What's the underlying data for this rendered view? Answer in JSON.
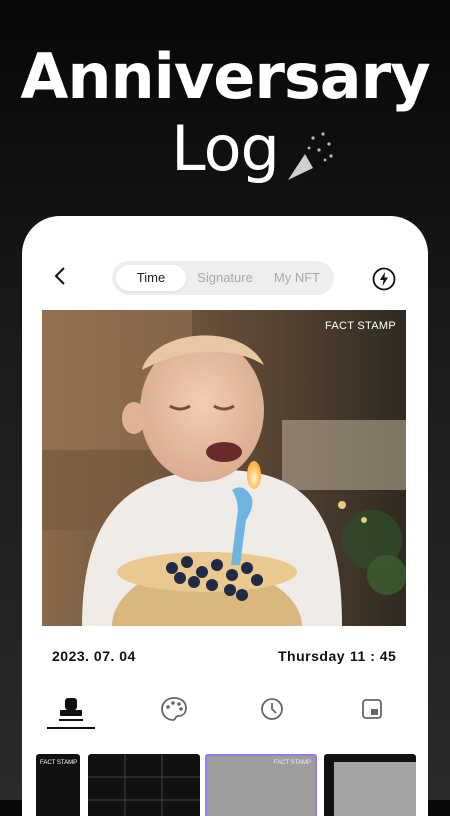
{
  "headline": {
    "line1": "Anniversary",
    "line2": "Log"
  },
  "tabs": [
    {
      "label": "Time"
    },
    {
      "label": "Signature"
    },
    {
      "label": "My NFT"
    }
  ],
  "photo": {
    "stamp_label": "FACT STAMP"
  },
  "info": {
    "date": "2023. 07. 04",
    "day": "Thursday",
    "time": "11 : 45"
  },
  "tools": [
    "stamp-icon",
    "palette-icon",
    "clock-icon",
    "frame-icon"
  ],
  "thumbs": {
    "t1": "FACT STAMP",
    "t2": "FACT STAMP",
    "t3": "FACT STAMP"
  },
  "colors": {
    "accent": "#8c7ff0",
    "background": "#1b1b1b",
    "panel": "#ffffff"
  }
}
